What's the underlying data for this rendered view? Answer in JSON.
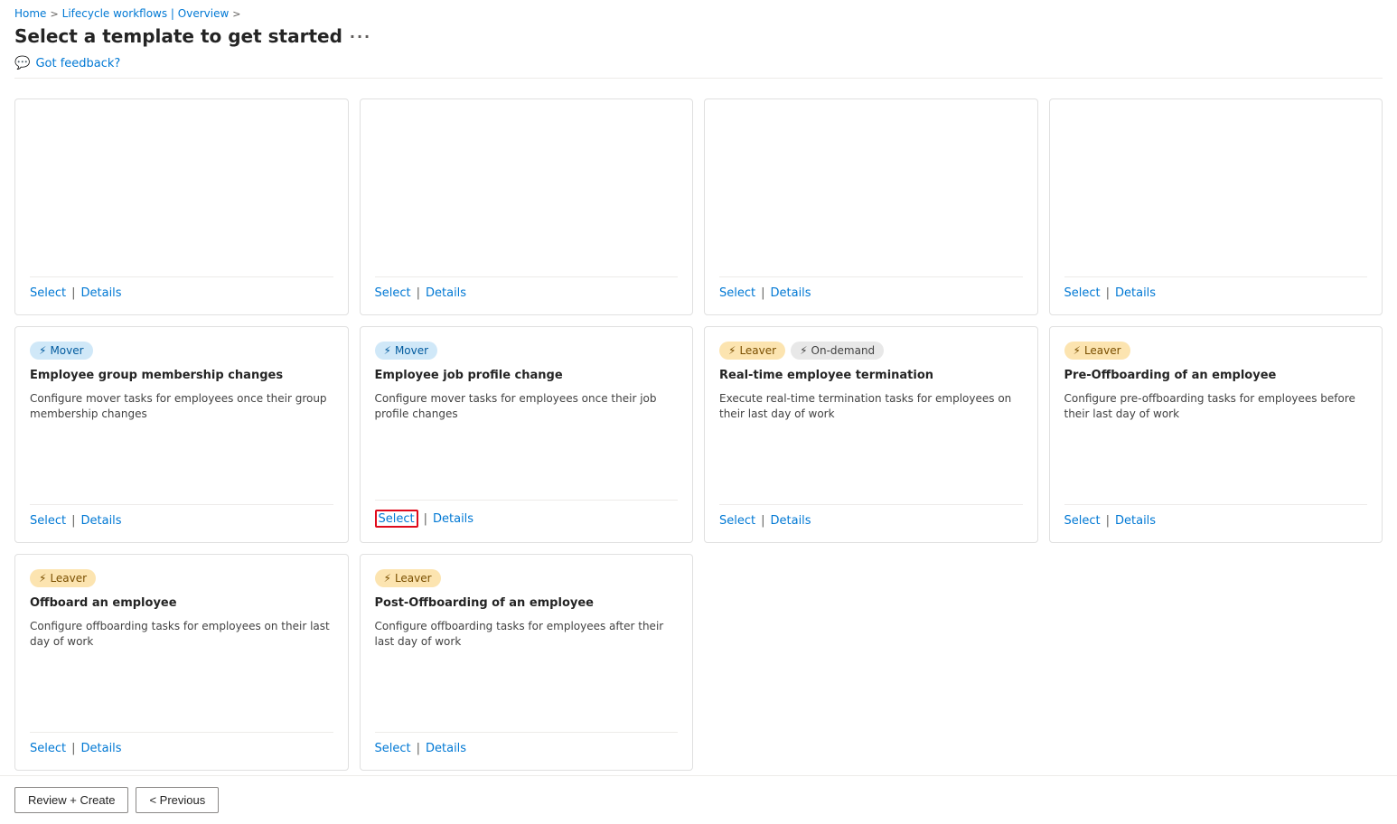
{
  "breadcrumb": {
    "home": "Home",
    "separator1": ">",
    "lifecycle": "Lifecycle workflows | Overview",
    "separator2": ">"
  },
  "page": {
    "title": "Select a template to get started",
    "ellipsis": "···",
    "feedback": "Got feedback?"
  },
  "cards": [
    {
      "id": "card-1",
      "badge": null,
      "title": "",
      "desc": "",
      "select": "Select",
      "details": "Details",
      "hasHighlight": false,
      "empty_top": true
    },
    {
      "id": "card-2",
      "badge": null,
      "title": "",
      "desc": "",
      "select": "Select",
      "details": "Details",
      "hasHighlight": false,
      "empty_top": true
    },
    {
      "id": "card-3",
      "badge": null,
      "title": "",
      "desc": "",
      "select": "Select",
      "details": "Details",
      "hasHighlight": false,
      "empty_top": true
    },
    {
      "id": "card-4",
      "badge": null,
      "title": "",
      "desc": "",
      "select": "Select",
      "details": "Details",
      "hasHighlight": false,
      "empty_top": true
    },
    {
      "id": "card-5",
      "badges": [
        {
          "type": "mover",
          "label": "Mover"
        }
      ],
      "title": "Employee group membership changes",
      "desc": "Configure mover tasks for employees once their group membership changes",
      "select": "Select",
      "details": "Details",
      "hasHighlight": false
    },
    {
      "id": "card-6",
      "badges": [
        {
          "type": "mover",
          "label": "Mover"
        }
      ],
      "title": "Employee job profile change",
      "desc": "Configure mover tasks for employees once their job profile changes",
      "select": "Select",
      "details": "Details",
      "hasHighlight": true
    },
    {
      "id": "card-7",
      "badges": [
        {
          "type": "leaver",
          "label": "Leaver"
        },
        {
          "type": "ondemand",
          "label": "On-demand"
        }
      ],
      "title": "Real-time employee termination",
      "desc": "Execute real-time termination tasks for employees on their last day of work",
      "select": "Select",
      "details": "Details",
      "hasHighlight": false
    },
    {
      "id": "card-8",
      "badges": [
        {
          "type": "leaver",
          "label": "Leaver"
        }
      ],
      "title": "Pre-Offboarding of an employee",
      "desc": "Configure pre-offboarding tasks for employees before their last day of work",
      "select": "Select",
      "details": "Details",
      "hasHighlight": false
    },
    {
      "id": "card-9",
      "badges": [
        {
          "type": "leaver",
          "label": "Leaver"
        }
      ],
      "title": "Offboard an employee",
      "desc": "Configure offboarding tasks for employees on their last day of work",
      "select": "Select",
      "details": "Details",
      "hasHighlight": false
    },
    {
      "id": "card-10",
      "badges": [
        {
          "type": "leaver",
          "label": "Leaver"
        }
      ],
      "title": "Post-Offboarding of an employee",
      "desc": "Configure offboarding tasks for employees after their last day of work",
      "select": "Select",
      "details": "Details",
      "hasHighlight": false
    }
  ],
  "bottom": {
    "review_create": "Review + Create",
    "previous": "< Previous",
    "select_details": "Select Details"
  },
  "icons": {
    "person_icon": "⚡",
    "feedback_icon": "💬",
    "mover_icon": "👤",
    "leaver_icon": "👤"
  }
}
